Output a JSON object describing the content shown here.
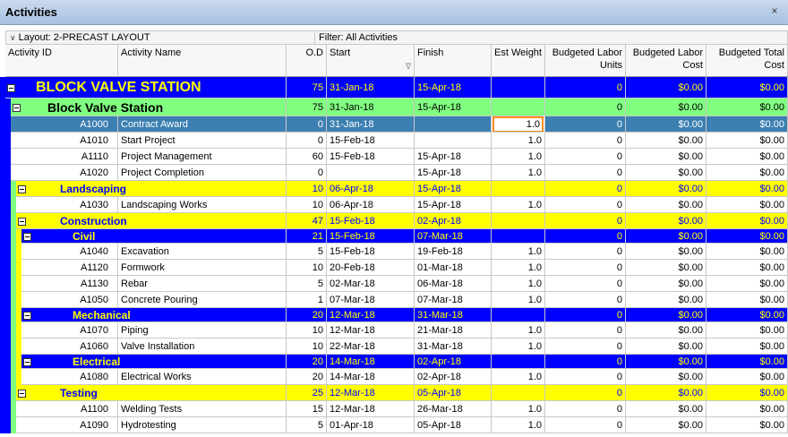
{
  "window": {
    "title": "Activities",
    "close_glyph": "×"
  },
  "toolbar": {
    "layout": "Layout: 2-PRECAST LAYOUT",
    "filter": "Filter: All Activities"
  },
  "columns": {
    "activity_id": "Activity ID",
    "activity_name": "Activity Name",
    "od": "O.D",
    "start": "Start",
    "finish": "Finish",
    "est_weight": "Est Weight",
    "bl_units": [
      "Budgeted Labor",
      "Units"
    ],
    "bl_cost": [
      "Budgeted Labor",
      "Cost"
    ],
    "bt_cost": [
      "Budgeted Total",
      "Cost"
    ]
  },
  "rows": [
    {
      "type": "wbs",
      "level": 0,
      "name": "BLOCK VALVE STATION",
      "od": "75",
      "start": "31-Jan-18",
      "finish": "15-Apr-18",
      "weight": "",
      "units": "0",
      "lcost": "$0.00",
      "tcost": "$0.00"
    },
    {
      "type": "wbs",
      "level": 1,
      "name": "Block Valve Station",
      "od": "75",
      "start": "31-Jan-18",
      "finish": "15-Apr-18",
      "weight": "",
      "units": "0",
      "lcost": "$0.00",
      "tcost": "$0.00"
    },
    {
      "type": "act",
      "indent": 1,
      "selected": true,
      "id": "A1000",
      "name": "Contract Award",
      "od": "0",
      "start": "31-Jan-18",
      "finish": "",
      "weight": "1.0",
      "units": "0",
      "lcost": "$0.00",
      "tcost": "$0.00"
    },
    {
      "type": "act",
      "indent": 1,
      "id": "A1010",
      "name": "Start Project",
      "od": "0",
      "start": "15-Feb-18",
      "finish": "",
      "weight": "1.0",
      "units": "0",
      "lcost": "$0.00",
      "tcost": "$0.00"
    },
    {
      "type": "act",
      "indent": 1,
      "id": "A1110",
      "name": "Project Management",
      "od": "60",
      "start": "15-Feb-18",
      "finish": "15-Apr-18",
      "weight": "1.0",
      "units": "0",
      "lcost": "$0.00",
      "tcost": "$0.00"
    },
    {
      "type": "act",
      "indent": 1,
      "id": "A1020",
      "name": "Project Completion",
      "od": "0",
      "start": "",
      "finish": "15-Apr-18",
      "weight": "1.0",
      "units": "0",
      "lcost": "$0.00",
      "tcost": "$0.00"
    },
    {
      "type": "wbs",
      "level": 2,
      "color": "yellow",
      "name": "Landscaping",
      "od": "10",
      "start": "06-Apr-18",
      "finish": "15-Apr-18",
      "weight": "",
      "units": "0",
      "lcost": "$0.00",
      "tcost": "$0.00"
    },
    {
      "type": "act",
      "indent": 2,
      "id": "A1030",
      "name": "Landscaping Works",
      "od": "10",
      "start": "06-Apr-18",
      "finish": "15-Apr-18",
      "weight": "1.0",
      "units": "0",
      "lcost": "$0.00",
      "tcost": "$0.00"
    },
    {
      "type": "wbs",
      "level": 2,
      "color": "yellow",
      "name": "Construction",
      "od": "47",
      "start": "15-Feb-18",
      "finish": "02-Apr-18",
      "weight": "",
      "units": "0",
      "lcost": "$0.00",
      "tcost": "$0.00"
    },
    {
      "type": "wbs",
      "level": 3,
      "name": "Civil",
      "od": "21",
      "start": "15-Feb-18",
      "finish": "07-Mar-18",
      "weight": "",
      "units": "0",
      "lcost": "$0.00",
      "tcost": "$0.00"
    },
    {
      "type": "act",
      "indent": 3,
      "id": "A1040",
      "name": "Excavation",
      "od": "5",
      "start": "15-Feb-18",
      "finish": "19-Feb-18",
      "weight": "1.0",
      "units": "0",
      "lcost": "$0.00",
      "tcost": "$0.00"
    },
    {
      "type": "act",
      "indent": 3,
      "id": "A1120",
      "name": "Formwork",
      "od": "10",
      "start": "20-Feb-18",
      "finish": "01-Mar-18",
      "weight": "1.0",
      "units": "0",
      "lcost": "$0.00",
      "tcost": "$0.00"
    },
    {
      "type": "act",
      "indent": 3,
      "id": "A1130",
      "name": "Rebar",
      "od": "5",
      "start": "02-Mar-18",
      "finish": "06-Mar-18",
      "weight": "1.0",
      "units": "0",
      "lcost": "$0.00",
      "tcost": "$0.00"
    },
    {
      "type": "act",
      "indent": 3,
      "id": "A1050",
      "name": "Concrete Pouring",
      "od": "1",
      "start": "07-Mar-18",
      "finish": "07-Mar-18",
      "weight": "1.0",
      "units": "0",
      "lcost": "$0.00",
      "tcost": "$0.00"
    },
    {
      "type": "wbs",
      "level": 3,
      "name": "Mechanical",
      "od": "20",
      "start": "12-Mar-18",
      "finish": "31-Mar-18",
      "weight": "",
      "units": "0",
      "lcost": "$0.00",
      "tcost": "$0.00"
    },
    {
      "type": "act",
      "indent": 3,
      "id": "A1070",
      "name": "Piping",
      "od": "10",
      "start": "12-Mar-18",
      "finish": "21-Mar-18",
      "weight": "1.0",
      "units": "0",
      "lcost": "$0.00",
      "tcost": "$0.00"
    },
    {
      "type": "act",
      "indent": 3,
      "id": "A1060",
      "name": "Valve Installation",
      "od": "10",
      "start": "22-Mar-18",
      "finish": "31-Mar-18",
      "weight": "1.0",
      "units": "0",
      "lcost": "$0.00",
      "tcost": "$0.00"
    },
    {
      "type": "wbs",
      "level": 3,
      "name": "Electrical",
      "od": "20",
      "start": "14-Mar-18",
      "finish": "02-Apr-18",
      "weight": "",
      "units": "0",
      "lcost": "$0.00",
      "tcost": "$0.00"
    },
    {
      "type": "act",
      "indent": 3,
      "id": "A1080",
      "name": "Electrical Works",
      "od": "20",
      "start": "14-Mar-18",
      "finish": "02-Apr-18",
      "weight": "1.0",
      "units": "0",
      "lcost": "$0.00",
      "tcost": "$0.00"
    },
    {
      "type": "wbs",
      "level": 2,
      "color": "yellow",
      "name": "Testing",
      "od": "25",
      "start": "12-Mar-18",
      "finish": "05-Apr-18",
      "weight": "",
      "units": "0",
      "lcost": "$0.00",
      "tcost": "$0.00"
    },
    {
      "type": "act",
      "indent": 2,
      "id": "A1100",
      "name": "Welding Tests",
      "od": "15",
      "start": "12-Mar-18",
      "finish": "26-Mar-18",
      "weight": "1.0",
      "units": "0",
      "lcost": "$0.00",
      "tcost": "$0.00"
    },
    {
      "type": "act",
      "indent": 2,
      "id": "A1090",
      "name": "Hydrotesting",
      "od": "5",
      "start": "01-Apr-18",
      "finish": "05-Apr-18",
      "weight": "1.0",
      "units": "0",
      "lcost": "$0.00",
      "tcost": "$0.00"
    }
  ],
  "colors": {
    "wbs_blue": "#0000ff",
    "wbs_green": "#80ff80",
    "wbs_yellow": "#ffff00",
    "selected_row": "#3c7fb1",
    "edit_border": "#ff8c1a"
  }
}
